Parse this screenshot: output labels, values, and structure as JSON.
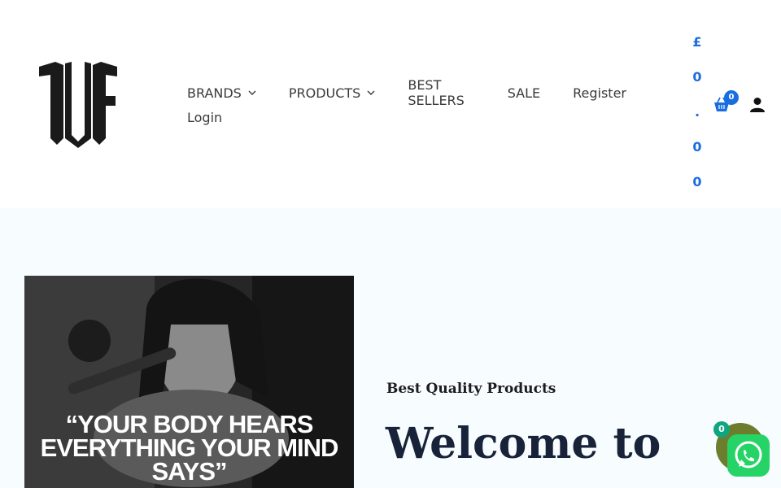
{
  "header": {
    "nav_items": [
      {
        "label": "BRANDS",
        "has_dropdown": true
      },
      {
        "label": "PRODUCTS",
        "has_dropdown": true
      },
      {
        "label": "BEST SELLERS",
        "has_dropdown": false
      },
      {
        "label": "SALE",
        "has_dropdown": false
      },
      {
        "label": "Register",
        "has_dropdown": false
      },
      {
        "label": "Login",
        "has_dropdown": false
      }
    ],
    "cart_total_chars": [
      "£",
      "0",
      ".",
      "0",
      "0"
    ],
    "cart_count": "0",
    "icons": [
      "logo",
      "chevron-down-icon",
      "basket-icon",
      "user-icon"
    ]
  },
  "hero": {
    "image_quote": "“YOUR BODY HEARS EVERYTHING YOUR MIND SAYS”",
    "tagline": "Best Quality Products",
    "heading": "Welcome to"
  },
  "floating": {
    "badge_count": "0",
    "whatsapp_icon": "whatsapp-icon"
  },
  "colors": {
    "accent": "#1a6ddf",
    "hero_bg": "#f7fcff",
    "heading": "#182238",
    "whatsapp": "#25d366"
  }
}
